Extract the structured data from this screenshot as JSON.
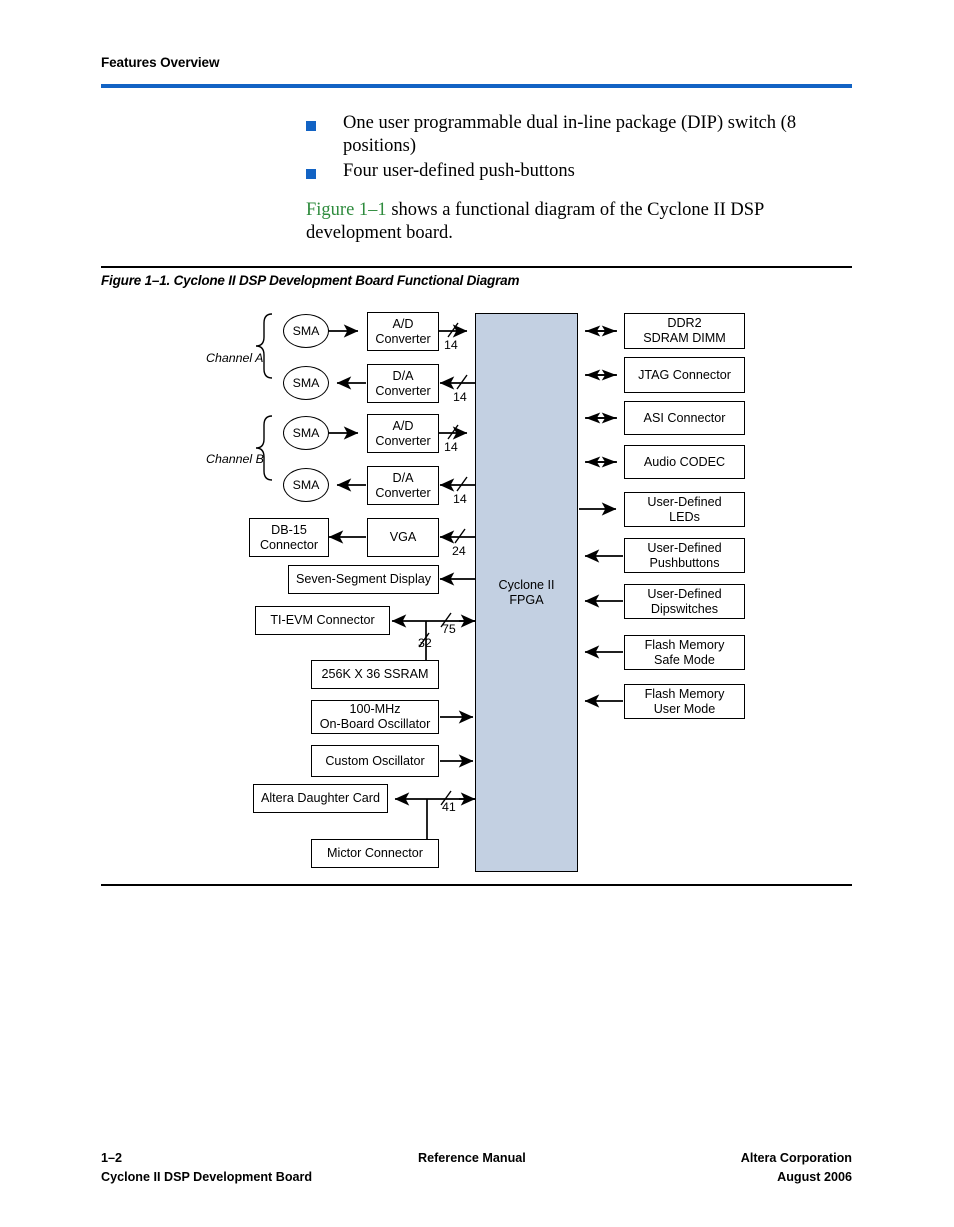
{
  "header": {
    "title": "Features Overview",
    "rule_color": "#1263c4"
  },
  "bullets": [
    "One user programmable dual in-line package (DIP) switch (8 positions)",
    "Four user-defined push-buttons"
  ],
  "paragraph": {
    "link": "Figure 1–1",
    "rest": " shows a functional diagram of the Cyclone II DSP development board.",
    "link_color": "#2e8b3d"
  },
  "figure": {
    "caption": "Figure 1–1. Cyclone II DSP Development Board Functional Diagram",
    "fpga": {
      "line1": "Cyclone II",
      "line2": "FPGA",
      "fill": "#c3d0e2"
    },
    "channels": [
      "Channel A",
      "Channel B"
    ],
    "sma_label": "SMA",
    "left_blocks": [
      {
        "line1": "A/D",
        "line2": "Converter",
        "bus": "14"
      },
      {
        "line1": "D/A",
        "line2": "Converter",
        "bus": "14"
      },
      {
        "line1": "A/D",
        "line2": "Converter",
        "bus": "14"
      },
      {
        "line1": "D/A",
        "line2": "Converter",
        "bus": "14"
      },
      {
        "line1": "DB-15",
        "line2": "Connector",
        "bus": ""
      },
      {
        "line1": "VGA",
        "line2": "",
        "bus": "24"
      },
      {
        "line1": "Seven-Segment Display",
        "line2": "",
        "bus": ""
      },
      {
        "line1": "TI-EVM Connector",
        "line2": "",
        "bus": "75"
      },
      {
        "line1": "256K X 36 SSRAM",
        "line2": "",
        "bus": "32"
      },
      {
        "line1": "100-MHz",
        "line2": "On-Board Oscillator",
        "bus": ""
      },
      {
        "line1": "Custom Oscillator",
        "line2": "",
        "bus": ""
      },
      {
        "line1": "Altera Daughter Card",
        "line2": "",
        "bus": "41"
      },
      {
        "line1": "Mictor Connector",
        "line2": "",
        "bus": ""
      }
    ],
    "right_blocks": [
      {
        "line1": "DDR2",
        "line2": "SDRAM DIMM",
        "dir": "both"
      },
      {
        "line1": "JTAG Connector",
        "line2": "",
        "dir": "both"
      },
      {
        "line1": "ASI Connector",
        "line2": "",
        "dir": "both"
      },
      {
        "line1": "Audio CODEC",
        "line2": "",
        "dir": "both"
      },
      {
        "line1": "User-Defined",
        "line2": "LEDs",
        "dir": "out"
      },
      {
        "line1": "User-Defined",
        "line2": "Pushbuttons",
        "dir": "in"
      },
      {
        "line1": "User-Defined",
        "line2": "Dipswitches",
        "dir": "in"
      },
      {
        "line1": "Flash Memory",
        "line2": "Safe Mode",
        "dir": "in"
      },
      {
        "line1": "Flash Memory",
        "line2": "User Mode",
        "dir": "in"
      }
    ]
  },
  "footer": {
    "page_num": "1–2",
    "doc_title": "Cyclone II DSP Development Board",
    "center": "Reference Manual",
    "company": "Altera Corporation",
    "date": "August 2006"
  }
}
